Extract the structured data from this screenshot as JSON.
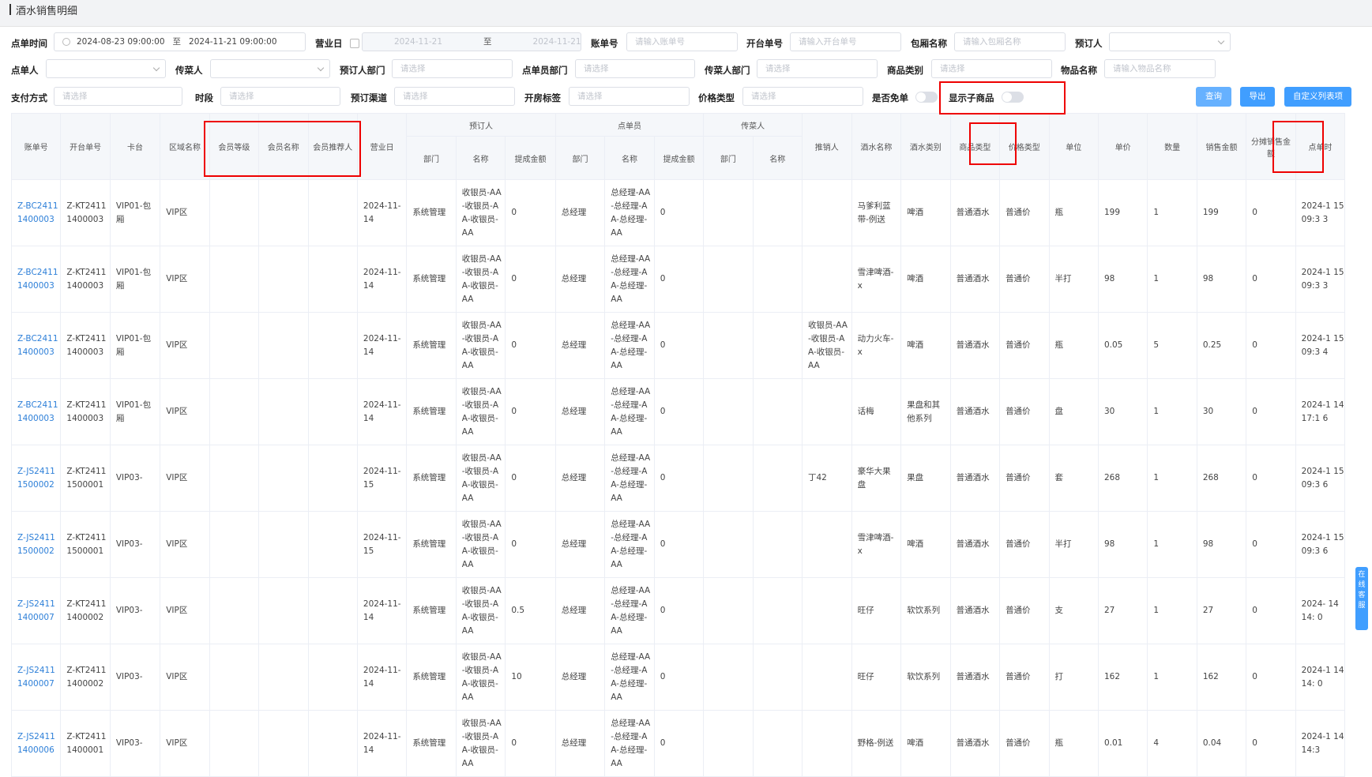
{
  "title": "酒水销售明细",
  "filters": {
    "order_time_label": "点单时间",
    "order_time_start": "2024-08-23 09:00:00",
    "order_time_end": "2024-11-21 09:00:00",
    "range_sep": "至",
    "business_day_label": "营业日",
    "business_day_start": "2024-11-21",
    "business_day_end": "2024-11-21",
    "bill_no_label": "账单号",
    "bill_no_placeholder": "请输入账单号",
    "open_no_label": "开台单号",
    "open_no_placeholder": "请输入开台单号",
    "room_name_label": "包厢名称",
    "room_name_placeholder": "请输入包厢名称",
    "reserver_label": "预订人",
    "orderer_label": "点单人",
    "server_label": "传菜人",
    "reserver_dept_label": "预订人部门",
    "select_placeholder": "请选择",
    "orderer_dept_label": "点单员部门",
    "server_dept_label": "传菜人部门",
    "category_label": "商品类别",
    "item_name_label": "物品名称",
    "item_name_placeholder": "请输入物品名称",
    "payment_label": "支付方式",
    "period_label": "时段",
    "channel_label": "预订渠道",
    "tag_label": "开房标签",
    "price_type_label": "价格类型",
    "free_label": "是否免单",
    "show_sub_label": "显示子商品"
  },
  "buttons": {
    "query": "查询",
    "export": "导出",
    "custom_columns": "自定义列表项"
  },
  "service_label": "在线客服",
  "table": {
    "headers": {
      "bill_no": "账单号",
      "open_no": "开台单号",
      "booth": "卡台",
      "area": "区域名称",
      "member_level": "会员等级",
      "member_name": "会员名称",
      "member_referrer": "会员推荐人",
      "business_day": "营业日",
      "reserver": "预订人",
      "orderer": "点单员",
      "server": "传菜人",
      "dept": "部门",
      "name": "名称",
      "commission": "提成金额",
      "promoter": "推销人",
      "drink_name": "酒水名称",
      "drink_type": "酒水类别",
      "product_type": "商品类型",
      "price_type": "价格类型",
      "unit": "单位",
      "unit_price": "单价",
      "qty": "数量",
      "sales_amount": "销售金额",
      "split_amount": "分摊销售金额",
      "order_time": "点单时"
    },
    "rows": [
      {
        "bill_no": "Z-BC2411 1400003",
        "open_no": "Z-KT2411 1400003",
        "booth": "VIP01-包 厢",
        "area": "VIP区",
        "day": "2024-11- 14",
        "r_dept": "系统管理",
        "r_name": "收银员-AA -收银员-A A-收银员- AA",
        "r_comm": "0",
        "o_dept": "总经理",
        "o_name": "总经理-AA -总经理-A A-总经理- AA",
        "o_comm": "0",
        "promoter": "",
        "drink": "马爹利蓝 带-例送",
        "dtype": "啤酒",
        "ptype": "普通酒水",
        "price_type": "普通价",
        "unit": "瓶",
        "price": "199",
        "qty": "1",
        "amount": "199",
        "split": "0",
        "time": "2024-1 15 09:3 3"
      },
      {
        "bill_no": "Z-BC2411 1400003",
        "open_no": "Z-KT2411 1400003",
        "booth": "VIP01-包 厢",
        "area": "VIP区",
        "day": "2024-11- 14",
        "r_dept": "系统管理",
        "r_name": "收银员-AA -收银员-A A-收银员- AA",
        "r_comm": "0",
        "o_dept": "总经理",
        "o_name": "总经理-AA -总经理-A A-总经理- AA",
        "o_comm": "0",
        "promoter": "",
        "drink": "雪津啤酒- x",
        "dtype": "啤酒",
        "ptype": "普通酒水",
        "price_type": "普通价",
        "unit": "半打",
        "price": "98",
        "qty": "1",
        "amount": "98",
        "split": "0",
        "time": "2024-1 15 09:3 3"
      },
      {
        "bill_no": "Z-BC2411 1400003",
        "open_no": "Z-KT2411 1400003",
        "booth": "VIP01-包 厢",
        "area": "VIP区",
        "day": "2024-11- 14",
        "r_dept": "系统管理",
        "r_name": "收银员-AA -收银员-A A-收银员- AA",
        "r_comm": "0",
        "o_dept": "总经理",
        "o_name": "总经理-AA -总经理-A A-总经理- AA",
        "o_comm": "0",
        "promoter": "收银员-AA -收银员-A A-收银员- AA",
        "drink": "动力火车- x",
        "dtype": "啤酒",
        "ptype": "普通酒水",
        "price_type": "普通价",
        "unit": "瓶",
        "price": "0.05",
        "qty": "5",
        "amount": "0.25",
        "split": "0",
        "time": "2024-1 15 09:3 4"
      },
      {
        "bill_no": "Z-BC2411 1400003",
        "open_no": "Z-KT2411 1400003",
        "booth": "VIP01-包 厢",
        "area": "VIP区",
        "day": "2024-11- 14",
        "r_dept": "系统管理",
        "r_name": "收银员-AA -收银员-A A-收银员- AA",
        "r_comm": "0",
        "o_dept": "总经理",
        "o_name": "总经理-AA -总经理-A A-总经理- AA",
        "o_comm": "0",
        "promoter": "",
        "drink": "话梅",
        "dtype": "果盘和其 他系列",
        "ptype": "普通酒水",
        "price_type": "普通价",
        "unit": "盘",
        "price": "30",
        "qty": "1",
        "amount": "30",
        "split": "0",
        "time": "2024-1 14 17:1 6"
      },
      {
        "bill_no": "Z-JS2411 1500002",
        "open_no": "Z-KT2411 1500001",
        "booth": "VIP03-",
        "area": "VIP区",
        "day": "2024-11- 15",
        "r_dept": "系统管理",
        "r_name": "收银员-AA -收银员-A A-收银员- AA",
        "r_comm": "0",
        "o_dept": "总经理",
        "o_name": "总经理-AA -总经理-A A-总经理- AA",
        "o_comm": "0",
        "promoter": "丁42",
        "drink": "豪华大果 盘",
        "dtype": "果盘",
        "ptype": "普通酒水",
        "price_type": "普通价",
        "unit": "套",
        "price": "268",
        "qty": "1",
        "amount": "268",
        "split": "0",
        "time": "2024-1 15 09:3 6"
      },
      {
        "bill_no": "Z-JS2411 1500002",
        "open_no": "Z-KT2411 1500001",
        "booth": "VIP03-",
        "area": "VIP区",
        "day": "2024-11- 15",
        "r_dept": "系统管理",
        "r_name": "收银员-AA -收银员-A A-收银员- AA",
        "r_comm": "0",
        "o_dept": "总经理",
        "o_name": "总经理-AA -总经理-A A-总经理- AA",
        "o_comm": "0",
        "promoter": "",
        "drink": "雪津啤酒- x",
        "dtype": "啤酒",
        "ptype": "普通酒水",
        "price_type": "普通价",
        "unit": "半打",
        "price": "98",
        "qty": "1",
        "amount": "98",
        "split": "0",
        "time": "2024-1 15 09:3 6"
      },
      {
        "bill_no": "Z-JS2411 1400007",
        "open_no": "Z-KT2411 1400002",
        "booth": "VIP03-",
        "area": "VIP区",
        "day": "2024-11- 14",
        "r_dept": "系统管理",
        "r_name": "收银员-AA -收银员-A A-收银员- AA",
        "r_comm": "0.5",
        "o_dept": "总经理",
        "o_name": "总经理-AA -总经理-A A-总经理- AA",
        "o_comm": "0",
        "promoter": "",
        "drink": "旺仔",
        "dtype": "软饮系列",
        "ptype": "普通酒水",
        "price_type": "普通价",
        "unit": "支",
        "price": "27",
        "qty": "1",
        "amount": "27",
        "split": "0",
        "time": "2024- 14 14: 0"
      },
      {
        "bill_no": "Z-JS2411 1400007",
        "open_no": "Z-KT2411 1400002",
        "booth": "VIP03-",
        "area": "VIP区",
        "day": "2024-11- 14",
        "r_dept": "系统管理",
        "r_name": "收银员-AA -收银员-A A-收银员- AA",
        "r_comm": "10",
        "o_dept": "总经理",
        "o_name": "总经理-AA -总经理-A A-总经理- AA",
        "o_comm": "0",
        "promoter": "",
        "drink": "旺仔",
        "dtype": "软饮系列",
        "ptype": "普通酒水",
        "price_type": "普通价",
        "unit": "打",
        "price": "162",
        "qty": "1",
        "amount": "162",
        "split": "0",
        "time": "2024-1 14 14: 0"
      },
      {
        "bill_no": "Z-JS2411 1400006",
        "open_no": "Z-KT2411 1400001",
        "booth": "VIP03-",
        "area": "VIP区",
        "day": "2024-11- 14",
        "r_dept": "系统管理",
        "r_name": "收银员-AA -收银员-A A-收银员- AA",
        "r_comm": "0",
        "o_dept": "总经理",
        "o_name": "总经理-AA -总经理-A A-总经理- AA",
        "o_comm": "0",
        "promoter": "",
        "drink": "野格-例送",
        "dtype": "啤酒",
        "ptype": "普通酒水",
        "price_type": "普通价",
        "unit": "瓶",
        "price": "0.01",
        "qty": "4",
        "amount": "0.04",
        "split": "0",
        "time": "2024-1 14 14:3"
      }
    ]
  }
}
